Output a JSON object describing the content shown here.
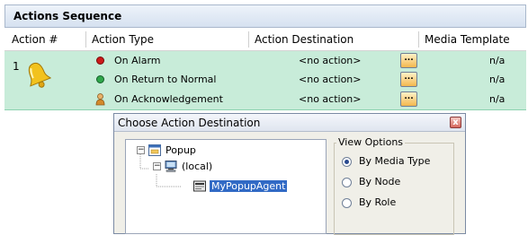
{
  "panel": {
    "title": "Actions Sequence",
    "columns": {
      "action_no": "Action #",
      "action_type": "Action Type",
      "action_destination": "Action Destination",
      "media_template": "Media Template"
    },
    "row_number": "1",
    "rows": [
      {
        "status_color": "#cc1a1a",
        "type": "On Alarm",
        "destination": "<no action>",
        "button": "...",
        "template": "n/a"
      },
      {
        "status_color": "#2fa64a",
        "type": "On Return to Normal",
        "destination": "<no action>",
        "button": "...",
        "template": "n/a"
      },
      {
        "status_icon": "acknowledge-person-icon",
        "type": "On Acknowledgement",
        "destination": "<no action>",
        "button": "...",
        "template": "n/a"
      }
    ],
    "row_icon": "bell-icon",
    "row_background": "#c8ecd9"
  },
  "dialog": {
    "title": "Choose Action Destination",
    "close_glyph": "x",
    "tree": [
      {
        "label": "Popup",
        "icon": "popup-window-icon",
        "expander": "−"
      },
      {
        "label": "(local)",
        "icon": "computer-icon",
        "expander": "−"
      },
      {
        "label": "MyPopupAgent",
        "icon": "agent-icon",
        "selected": true
      }
    ],
    "view_options": {
      "legend": "View Options",
      "options": [
        {
          "label": "By Media Type",
          "selected": true
        },
        {
          "label": "By Node",
          "selected": false
        },
        {
          "label": "By Role",
          "selected": false
        }
      ]
    }
  }
}
